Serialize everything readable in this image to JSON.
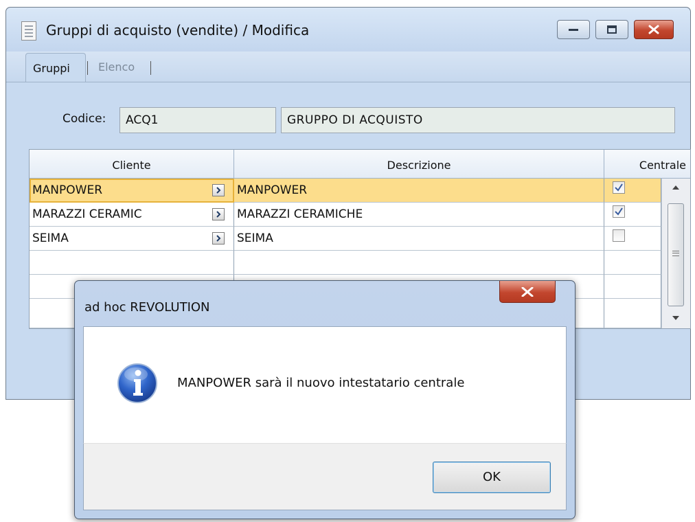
{
  "window": {
    "title": "Gruppi di acquisto (vendite) / Modifica"
  },
  "tabs": [
    {
      "label": "Gruppi"
    },
    {
      "label": "Elenco"
    }
  ],
  "form": {
    "codice_label": "Codice:",
    "codice_value": "ACQ1",
    "descrizione_value": "GRUPPO DI ACQUISTO"
  },
  "grid": {
    "headers": {
      "cliente": "Cliente",
      "descrizione": "Descrizione",
      "centrale": "Centrale"
    },
    "rows": [
      {
        "cliente": "MANPOWER",
        "descrizione": "MANPOWER",
        "centrale": true,
        "selected": true
      },
      {
        "cliente": "MARAZZI CERAMIC",
        "descrizione": "MARAZZI CERAMICHE",
        "centrale": true,
        "selected": false
      },
      {
        "cliente": "SEIMA",
        "descrizione": "SEIMA",
        "centrale": false,
        "selected": false
      }
    ]
  },
  "dialog": {
    "title": "ad hoc REVOLUTION",
    "message": "MANPOWER sarà il nuovo intestatario centrale",
    "icon": "info-icon",
    "ok_label": "OK"
  },
  "colors": {
    "selected_row": "#fcdd8c",
    "title_bar": "#c9dbf0",
    "close_button": "#c2462e"
  }
}
